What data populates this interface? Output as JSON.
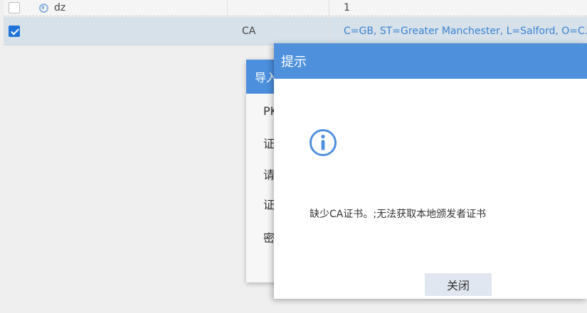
{
  "table": {
    "rows": [
      {
        "name": "dz",
        "type": "",
        "subject": "1",
        "checked": false
      },
      {
        "name": "",
        "type": "CA",
        "subject": "C=GB, ST=Greater Manchester, L=Salford, O=C...",
        "checked": true
      }
    ]
  },
  "import_menu": {
    "title": "导入",
    "items": [
      "PK",
      "证",
      "请",
      "证",
      "密"
    ]
  },
  "modal": {
    "title": "提示",
    "icon": "info-icon",
    "message": "缺少CA证书。;无法获取本地颁发者证书",
    "close_label": "关闭"
  },
  "colors": {
    "header_blue": "#4f90dd",
    "subject_link": "#3b82d0",
    "checkbox_blue": "#1e73d8"
  }
}
